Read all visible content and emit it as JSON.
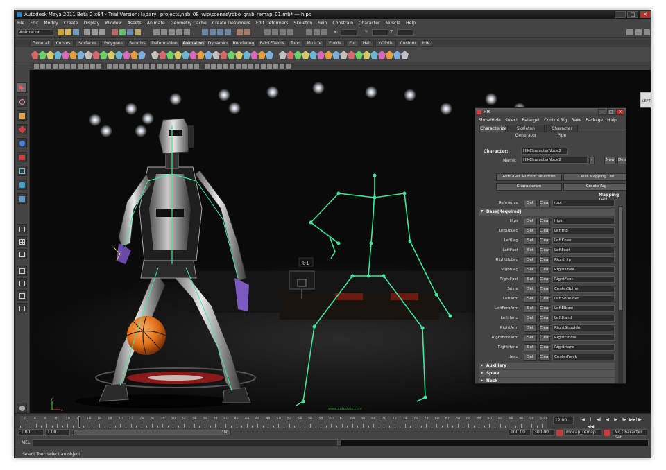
{
  "window": {
    "title": "Autodesk Maya 2011 Beta 2 x64 - Trial Version: I:\\daryl_projects\\nab_08_wip\\scenes\\robo_grab_remap_01.mb*  ---  hips",
    "controls": [
      "_",
      "□",
      "✕"
    ]
  },
  "menubar": [
    "File",
    "Edit",
    "Modify",
    "Create",
    "Display",
    "Window",
    "Assets",
    "Animate",
    "Geometry Cache",
    "Create Deformers",
    "Edit Deformers",
    "Skeleton",
    "Skin",
    "Constrain",
    "Character",
    "Muscle",
    "Help"
  ],
  "statusline": {
    "mode": "Animation",
    "x_label": "X:",
    "y_label": "Y:",
    "z_label": "Z:"
  },
  "shelf_tabs": [
    "General",
    "Curves",
    "Surfaces",
    "Polygons",
    "Subdivs",
    "Deformation",
    "Animation",
    "Dynamics",
    "Rendering",
    "PaintEffects",
    "Toon",
    "Muscle",
    "Fluids",
    "Fur",
    "Hair",
    "nCloth",
    "Custom",
    "HIK"
  ],
  "shelf_active": "Animation",
  "viewport": {
    "scoreboard": "01",
    "watermark": "www.autodesk.com",
    "axis_x": "x",
    "axis_y": "y",
    "corner_label": "LEFT"
  },
  "hik": {
    "title": "HIK",
    "menu": [
      "Show/Hide",
      "Select",
      "Retarget",
      "Control Rig",
      "Bake",
      "Package",
      "Help"
    ],
    "tabs": [
      "Characterize",
      "Skeleton Generator",
      "Character Pipe"
    ],
    "character_label": "Character:",
    "character_value": "HIKCharacterNode2",
    "name_label": "Name:",
    "name_value": "HIKCharacterNode2",
    "new_label": "New",
    "delete_label": "Delete",
    "auto_get_label": "Auto-Get All from Selection",
    "clear_mapping_label": "Clear Mapping List",
    "characterize_label": "Characterize",
    "create_rig_label": "Create Rig",
    "mapping_list_label": "Mapping List",
    "reference_label": "Reference",
    "reference_value": "root",
    "set_label": "Set",
    "clear_label": "Clear",
    "base_section": "Base(Required)",
    "mappings": [
      {
        "label": "Hips",
        "value": "hips"
      },
      {
        "label": "LeftUpLeg",
        "value": "LeftHip"
      },
      {
        "label": "LeftLeg",
        "value": "LeftKnee"
      },
      {
        "label": "LeftFoot",
        "value": "LeftFoot"
      },
      {
        "label": "RightUpLeg",
        "value": "RightHip"
      },
      {
        "label": "RightLeg",
        "value": "RightKnee"
      },
      {
        "label": "RightFoot",
        "value": "RightFoot"
      },
      {
        "label": "Spine",
        "value": "CenterSpine"
      },
      {
        "label": "LeftArm",
        "value": "LeftShoulder"
      },
      {
        "label": "LeftForeArm",
        "value": "LeftElbow"
      },
      {
        "label": "LeftHand",
        "value": "LeftHand"
      },
      {
        "label": "RightArm",
        "value": "RightShoulder"
      },
      {
        "label": "RightForeArm",
        "value": "RightElbow"
      },
      {
        "label": "RightHand",
        "value": "RightHand"
      },
      {
        "label": "Head",
        "value": "CenterNeck"
      }
    ],
    "collapsed_sections": [
      "Auxiliary",
      "Spine",
      "Neck"
    ]
  },
  "timeline": {
    "ticks": [
      2,
      4,
      6,
      8,
      10,
      12,
      14,
      16,
      18,
      20,
      22,
      24,
      26,
      28,
      30,
      32,
      34,
      36,
      38,
      40,
      42,
      44,
      46,
      48,
      50,
      52,
      54,
      56,
      58,
      60,
      62,
      64,
      66,
      68,
      70,
      72,
      74,
      76,
      78,
      80,
      82,
      84,
      86,
      88,
      90,
      92,
      94,
      96,
      98,
      100
    ],
    "current_frame": "12.00",
    "playback": [
      "|◀",
      "|◀◀",
      "◀|",
      "◀",
      "▶",
      "|▶",
      "▶▶|",
      "▶|"
    ]
  },
  "range": {
    "start_time": "1.00",
    "start_range": "1.00",
    "slider_start": "1",
    "slider_end": "100",
    "end_range": "100.00",
    "end_time": "300.00",
    "anim_layer": "mocap_remap",
    "character_set": "No Character Set"
  },
  "command": {
    "label": "MEL"
  },
  "helpline": "Select Tool: select an object",
  "colors": {
    "skeleton_green": "#3ee89a",
    "accent_blue": "#2d7fbf"
  }
}
